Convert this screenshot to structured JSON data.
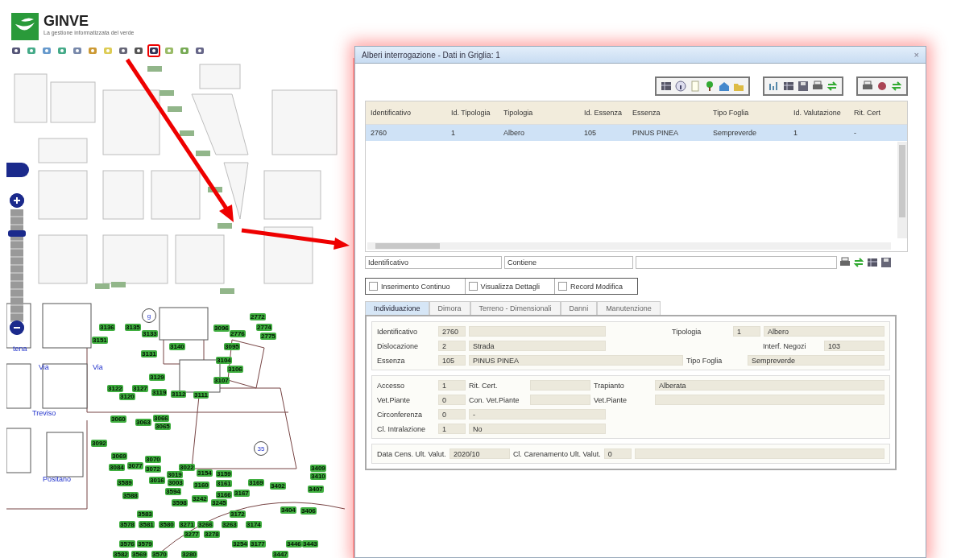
{
  "header": {
    "logo_title": "GINVE",
    "logo_subtitle": "La gestione informatizzata del verde"
  },
  "toolbar": {
    "tools": [
      {
        "highlighted": false
      },
      {
        "highlighted": false
      },
      {
        "highlighted": false
      },
      {
        "highlighted": false
      },
      {
        "highlighted": false
      },
      {
        "highlighted": false
      },
      {
        "highlighted": false
      },
      {
        "highlighted": false
      },
      {
        "highlighted": false
      },
      {
        "highlighted": true
      },
      {
        "highlighted": false
      },
      {
        "highlighted": false
      },
      {
        "highlighted": false
      }
    ]
  },
  "map": {
    "zoom": {
      "level": 0.8
    },
    "street_labels": [
      "Treviso",
      "Positano",
      "Via",
      "Via",
      "tena"
    ],
    "place_markers": [
      "g",
      "35"
    ],
    "tree_labels": [
      "3136",
      "3135",
      "3133",
      "3151",
      "3140",
      "3096",
      "2776",
      "2774",
      "2775",
      "2772",
      "3095",
      "3131",
      "3104",
      "3106",
      "3129",
      "3107",
      "3122",
      "3127",
      "3120",
      "3119",
      "3112",
      "3111",
      "3060",
      "3063",
      "3066",
      "3065",
      "3092",
      "3069",
      "3070",
      "3084",
      "3077",
      "3072",
      "3022",
      "3019",
      "3154",
      "3159",
      "3409",
      "3410",
      "3589",
      "3016",
      "3003",
      "3160",
      "3161",
      "3169",
      "3402",
      "3407",
      "3594",
      "3588",
      "3598",
      "3242",
      "3166",
      "3167",
      "3245",
      "3404",
      "3406",
      "3583",
      "3172",
      "3578",
      "3581",
      "3580",
      "3271",
      "3266",
      "3263",
      "3174",
      "3277",
      "3278",
      "3576",
      "3579",
      "3254",
      "3177",
      "3446",
      "3443",
      "3582",
      "3569",
      "3570",
      "3280",
      "3447"
    ]
  },
  "dialog": {
    "title": "Alberi interrogazione - Dati in Griglia: 1",
    "close_glyph": "×",
    "table": {
      "columns": [
        "Identificativo",
        "Id. Tipologia",
        "Tipologia",
        "Id. Essenza",
        "Essenza",
        "Tipo Foglia",
        "Id. Valutazione",
        "Rit. Cert"
      ],
      "rows": [
        {
          "selected": true,
          "cells": [
            "2760",
            "1",
            "Albero",
            "105",
            "PINUS PINEA",
            "Sempreverde",
            "1",
            "-"
          ]
        }
      ]
    },
    "filter": {
      "field": "Identificativo",
      "operator": "Contiene"
    },
    "checkboxes": [
      {
        "label": "Inserimento Continuo",
        "checked": false
      },
      {
        "label": "Visualizza Dettagli",
        "checked": false
      },
      {
        "label": "Record Modifica",
        "checked": false
      }
    ],
    "tabs": [
      {
        "label": "Individuazione",
        "selected": true
      },
      {
        "label": "Dimora",
        "selected": false
      },
      {
        "label": "Terreno - Dimensionali",
        "selected": false
      },
      {
        "label": "Danni",
        "selected": false
      },
      {
        "label": "Manutenzione",
        "selected": false
      }
    ],
    "sections": [
      {
        "rows": [
          {
            "items": [
              {
                "kind": "label",
                "text": "Identificativo"
              },
              {
                "kind": "code",
                "value": "2760"
              },
              {
                "kind": "medium"
              },
              {
                "kind": "gap"
              },
              {
                "kind": "label",
                "text": "Tipologia"
              },
              {
                "kind": "code",
                "value": "1"
              },
              {
                "kind": "long",
                "value": "Albero"
              }
            ]
          },
          {
            "items": [
              {
                "kind": "label",
                "text": "Dislocazione"
              },
              {
                "kind": "code",
                "value": "2"
              },
              {
                "kind": "medium",
                "value": "Strada"
              },
              {
                "kind": "gap"
              },
              {
                "kind": "label",
                "text": "Interf. Negozi"
              },
              {
                "kind": "short",
                "value": "103"
              }
            ]
          },
          {
            "items": [
              {
                "kind": "label",
                "text": "Essenza"
              },
              {
                "kind": "code",
                "value": "105"
              },
              {
                "kind": "long",
                "value": "PINUS PINEA"
              },
              {
                "kind": "label",
                "text": "Tipo Foglia"
              },
              {
                "kind": "medium",
                "value": "Sempreverde"
              }
            ]
          }
        ]
      },
      {
        "rows": [
          {
            "items": [
              {
                "kind": "label",
                "text": "Accesso"
              },
              {
                "kind": "code",
                "value": "1"
              },
              {
                "kind": "label",
                "text": "Rit. Cert."
              },
              {
                "kind": "short"
              },
              {
                "kind": "label",
                "text": "Trapianto"
              },
              {
                "kind": "long",
                "value": "Alberata"
              }
            ]
          },
          {
            "items": [
              {
                "kind": "label",
                "text": "Vet.Piante"
              },
              {
                "kind": "code",
                "value": "0"
              },
              {
                "kind": "label",
                "text": "Con. Vet.Piante"
              },
              {
                "kind": "short"
              },
              {
                "kind": "label",
                "text": "Vet.Piante"
              },
              {
                "kind": "long"
              }
            ]
          },
          {
            "items": [
              {
                "kind": "label",
                "text": "Circonferenza"
              },
              {
                "kind": "code",
                "value": "0"
              },
              {
                "kind": "medium",
                "value": "-"
              },
              {
                "kind": "gap"
              }
            ]
          },
          {
            "items": [
              {
                "kind": "label",
                "text": "Cl. Intralazione"
              },
              {
                "kind": "code",
                "value": "1"
              },
              {
                "kind": "medium",
                "value": "No"
              },
              {
                "kind": "gap"
              }
            ]
          }
        ]
      },
      {
        "rows": [
          {
            "items": [
              {
                "kind": "label",
                "text": "Data Cens. Ult. Valut."
              },
              {
                "kind": "short",
                "value": "2020/10"
              },
              {
                "kind": "label",
                "text": "Cl. Carenamento Ult. Valut."
              },
              {
                "kind": "code",
                "value": "0"
              },
              {
                "kind": "long"
              }
            ]
          }
        ]
      }
    ]
  }
}
